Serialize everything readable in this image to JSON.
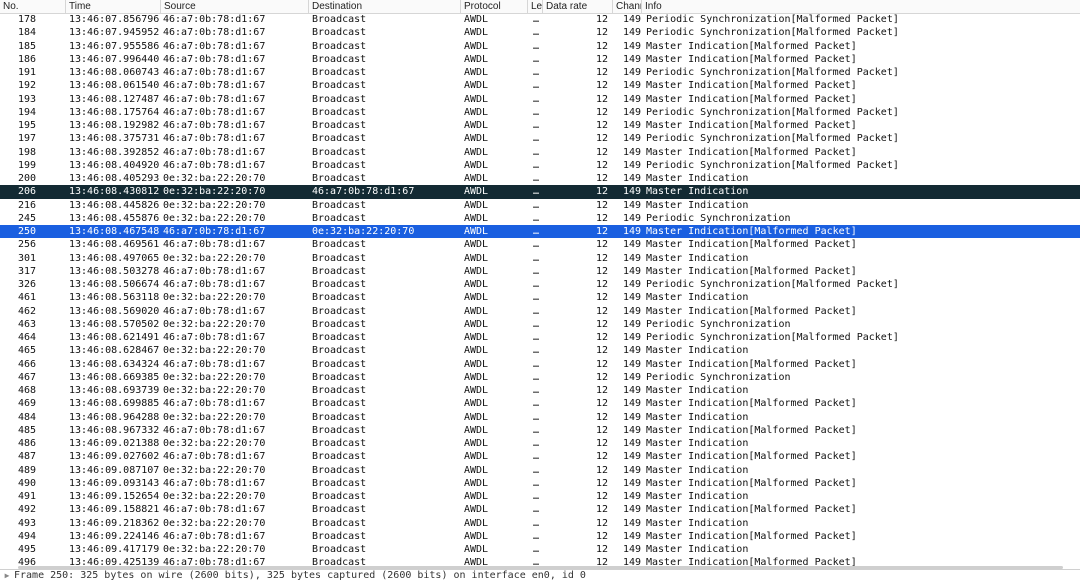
{
  "columns": {
    "no": "No.",
    "time": "Time",
    "source": "Source",
    "destination": "Destination",
    "protocol": "Protocol",
    "length": "Le",
    "data_rate": "Data rate",
    "channel": "Chanr",
    "info": "Info"
  },
  "packets": [
    {
      "no": "178",
      "time": "13:46:07.856796",
      "src": "46:a7:0b:78:d1:67",
      "dst": "Broadcast",
      "proto": "AWDL",
      "len": "…",
      "chan": "12",
      "rate": "149",
      "info": "Periodic Synchronization[Malformed Packet]"
    },
    {
      "no": "184",
      "time": "13:46:07.945952",
      "src": "46:a7:0b:78:d1:67",
      "dst": "Broadcast",
      "proto": "AWDL",
      "len": "…",
      "chan": "12",
      "rate": "149",
      "info": "Periodic Synchronization[Malformed Packet]"
    },
    {
      "no": "185",
      "time": "13:46:07.955586",
      "src": "46:a7:0b:78:d1:67",
      "dst": "Broadcast",
      "proto": "AWDL",
      "len": "…",
      "chan": "12",
      "rate": "149",
      "info": "Master Indication[Malformed Packet]"
    },
    {
      "no": "186",
      "time": "13:46:07.996440",
      "src": "46:a7:0b:78:d1:67",
      "dst": "Broadcast",
      "proto": "AWDL",
      "len": "…",
      "chan": "12",
      "rate": "149",
      "info": "Master Indication[Malformed Packet]"
    },
    {
      "no": "191",
      "time": "13:46:08.060743",
      "src": "46:a7:0b:78:d1:67",
      "dst": "Broadcast",
      "proto": "AWDL",
      "len": "…",
      "chan": "12",
      "rate": "149",
      "info": "Periodic Synchronization[Malformed Packet]"
    },
    {
      "no": "192",
      "time": "13:46:08.061540",
      "src": "46:a7:0b:78:d1:67",
      "dst": "Broadcast",
      "proto": "AWDL",
      "len": "…",
      "chan": "12",
      "rate": "149",
      "info": "Master Indication[Malformed Packet]"
    },
    {
      "no": "193",
      "time": "13:46:08.127487",
      "src": "46:a7:0b:78:d1:67",
      "dst": "Broadcast",
      "proto": "AWDL",
      "len": "…",
      "chan": "12",
      "rate": "149",
      "info": "Master Indication[Malformed Packet]"
    },
    {
      "no": "194",
      "time": "13:46:08.175764",
      "src": "46:a7:0b:78:d1:67",
      "dst": "Broadcast",
      "proto": "AWDL",
      "len": "…",
      "chan": "12",
      "rate": "149",
      "info": "Periodic Synchronization[Malformed Packet]"
    },
    {
      "no": "195",
      "time": "13:46:08.192982",
      "src": "46:a7:0b:78:d1:67",
      "dst": "Broadcast",
      "proto": "AWDL",
      "len": "…",
      "chan": "12",
      "rate": "149",
      "info": "Master Indication[Malformed Packet]"
    },
    {
      "no": "197",
      "time": "13:46:08.375731",
      "src": "46:a7:0b:78:d1:67",
      "dst": "Broadcast",
      "proto": "AWDL",
      "len": "…",
      "chan": "12",
      "rate": "149",
      "info": "Periodic Synchronization[Malformed Packet]"
    },
    {
      "no": "198",
      "time": "13:46:08.392852",
      "src": "46:a7:0b:78:d1:67",
      "dst": "Broadcast",
      "proto": "AWDL",
      "len": "…",
      "chan": "12",
      "rate": "149",
      "info": "Master Indication[Malformed Packet]"
    },
    {
      "no": "199",
      "time": "13:46:08.404920",
      "src": "46:a7:0b:78:d1:67",
      "dst": "Broadcast",
      "proto": "AWDL",
      "len": "…",
      "chan": "12",
      "rate": "149",
      "info": "Periodic Synchronization[Malformed Packet]"
    },
    {
      "no": "200",
      "time": "13:46:08.405293",
      "src": "0e:32:ba:22:20:70",
      "dst": "Broadcast",
      "proto": "AWDL",
      "len": "…",
      "chan": "12",
      "rate": "149",
      "info": "Master Indication"
    },
    {
      "no": "206",
      "time": "13:46:08.430812",
      "src": "0e:32:ba:22:20:70",
      "dst": "46:a7:0b:78:d1:67",
      "proto": "AWDL",
      "len": "…",
      "chan": "12",
      "rate": "149",
      "info": "Master Indication",
      "selected": "dark"
    },
    {
      "no": "216",
      "time": "13:46:08.445826",
      "src": "0e:32:ba:22:20:70",
      "dst": "Broadcast",
      "proto": "AWDL",
      "len": "…",
      "chan": "12",
      "rate": "149",
      "info": "Master Indication"
    },
    {
      "no": "245",
      "time": "13:46:08.455876",
      "src": "0e:32:ba:22:20:70",
      "dst": "Broadcast",
      "proto": "AWDL",
      "len": "…",
      "chan": "12",
      "rate": "149",
      "info": "Periodic Synchronization"
    },
    {
      "no": "250",
      "time": "13:46:08.467548",
      "src": "46:a7:0b:78:d1:67",
      "dst": "0e:32:ba:22:20:70",
      "proto": "AWDL",
      "len": "…",
      "chan": "12",
      "rate": "149",
      "info": "Master Indication[Malformed Packet]",
      "selected": "blue"
    },
    {
      "no": "256",
      "time": "13:46:08.469561",
      "src": "46:a7:0b:78:d1:67",
      "dst": "Broadcast",
      "proto": "AWDL",
      "len": "…",
      "chan": "12",
      "rate": "149",
      "info": "Master Indication[Malformed Packet]"
    },
    {
      "no": "301",
      "time": "13:46:08.497065",
      "src": "0e:32:ba:22:20:70",
      "dst": "Broadcast",
      "proto": "AWDL",
      "len": "…",
      "chan": "12",
      "rate": "149",
      "info": "Master Indication"
    },
    {
      "no": "317",
      "time": "13:46:08.503278",
      "src": "46:a7:0b:78:d1:67",
      "dst": "Broadcast",
      "proto": "AWDL",
      "len": "…",
      "chan": "12",
      "rate": "149",
      "info": "Master Indication[Malformed Packet]"
    },
    {
      "no": "326",
      "time": "13:46:08.506674",
      "src": "46:a7:0b:78:d1:67",
      "dst": "Broadcast",
      "proto": "AWDL",
      "len": "…",
      "chan": "12",
      "rate": "149",
      "info": "Periodic Synchronization[Malformed Packet]"
    },
    {
      "no": "461",
      "time": "13:46:08.563118",
      "src": "0e:32:ba:22:20:70",
      "dst": "Broadcast",
      "proto": "AWDL",
      "len": "…",
      "chan": "12",
      "rate": "149",
      "info": "Master Indication"
    },
    {
      "no": "462",
      "time": "13:46:08.569020",
      "src": "46:a7:0b:78:d1:67",
      "dst": "Broadcast",
      "proto": "AWDL",
      "len": "…",
      "chan": "12",
      "rate": "149",
      "info": "Master Indication[Malformed Packet]"
    },
    {
      "no": "463",
      "time": "13:46:08.570502",
      "src": "0e:32:ba:22:20:70",
      "dst": "Broadcast",
      "proto": "AWDL",
      "len": "…",
      "chan": "12",
      "rate": "149",
      "info": "Periodic Synchronization"
    },
    {
      "no": "464",
      "time": "13:46:08.621491",
      "src": "46:a7:0b:78:d1:67",
      "dst": "Broadcast",
      "proto": "AWDL",
      "len": "…",
      "chan": "12",
      "rate": "149",
      "info": "Periodic Synchronization[Malformed Packet]"
    },
    {
      "no": "465",
      "time": "13:46:08.628467",
      "src": "0e:32:ba:22:20:70",
      "dst": "Broadcast",
      "proto": "AWDL",
      "len": "…",
      "chan": "12",
      "rate": "149",
      "info": "Master Indication"
    },
    {
      "no": "466",
      "time": "13:46:08.634324",
      "src": "46:a7:0b:78:d1:67",
      "dst": "Broadcast",
      "proto": "AWDL",
      "len": "…",
      "chan": "12",
      "rate": "149",
      "info": "Master Indication[Malformed Packet]"
    },
    {
      "no": "467",
      "time": "13:46:08.669385",
      "src": "0e:32:ba:22:20:70",
      "dst": "Broadcast",
      "proto": "AWDL",
      "len": "…",
      "chan": "12",
      "rate": "149",
      "info": "Periodic Synchronization"
    },
    {
      "no": "468",
      "time": "13:46:08.693739",
      "src": "0e:32:ba:22:20:70",
      "dst": "Broadcast",
      "proto": "AWDL",
      "len": "…",
      "chan": "12",
      "rate": "149",
      "info": "Master Indication"
    },
    {
      "no": "469",
      "time": "13:46:08.699885",
      "src": "46:a7:0b:78:d1:67",
      "dst": "Broadcast",
      "proto": "AWDL",
      "len": "…",
      "chan": "12",
      "rate": "149",
      "info": "Master Indication[Malformed Packet]"
    },
    {
      "no": "484",
      "time": "13:46:08.964288",
      "src": "0e:32:ba:22:20:70",
      "dst": "Broadcast",
      "proto": "AWDL",
      "len": "…",
      "chan": "12",
      "rate": "149",
      "info": "Master Indication"
    },
    {
      "no": "485",
      "time": "13:46:08.967332",
      "src": "46:a7:0b:78:d1:67",
      "dst": "Broadcast",
      "proto": "AWDL",
      "len": "…",
      "chan": "12",
      "rate": "149",
      "info": "Master Indication[Malformed Packet]"
    },
    {
      "no": "486",
      "time": "13:46:09.021388",
      "src": "0e:32:ba:22:20:70",
      "dst": "Broadcast",
      "proto": "AWDL",
      "len": "…",
      "chan": "12",
      "rate": "149",
      "info": "Master Indication"
    },
    {
      "no": "487",
      "time": "13:46:09.027602",
      "src": "46:a7:0b:78:d1:67",
      "dst": "Broadcast",
      "proto": "AWDL",
      "len": "…",
      "chan": "12",
      "rate": "149",
      "info": "Master Indication[Malformed Packet]"
    },
    {
      "no": "489",
      "time": "13:46:09.087107",
      "src": "0e:32:ba:22:20:70",
      "dst": "Broadcast",
      "proto": "AWDL",
      "len": "…",
      "chan": "12",
      "rate": "149",
      "info": "Master Indication"
    },
    {
      "no": "490",
      "time": "13:46:09.093143",
      "src": "46:a7:0b:78:d1:67",
      "dst": "Broadcast",
      "proto": "AWDL",
      "len": "…",
      "chan": "12",
      "rate": "149",
      "info": "Master Indication[Malformed Packet]"
    },
    {
      "no": "491",
      "time": "13:46:09.152654",
      "src": "0e:32:ba:22:20:70",
      "dst": "Broadcast",
      "proto": "AWDL",
      "len": "…",
      "chan": "12",
      "rate": "149",
      "info": "Master Indication"
    },
    {
      "no": "492",
      "time": "13:46:09.158821",
      "src": "46:a7:0b:78:d1:67",
      "dst": "Broadcast",
      "proto": "AWDL",
      "len": "…",
      "chan": "12",
      "rate": "149",
      "info": "Master Indication[Malformed Packet]"
    },
    {
      "no": "493",
      "time": "13:46:09.218362",
      "src": "0e:32:ba:22:20:70",
      "dst": "Broadcast",
      "proto": "AWDL",
      "len": "…",
      "chan": "12",
      "rate": "149",
      "info": "Master Indication"
    },
    {
      "no": "494",
      "time": "13:46:09.224146",
      "src": "46:a7:0b:78:d1:67",
      "dst": "Broadcast",
      "proto": "AWDL",
      "len": "…",
      "chan": "12",
      "rate": "149",
      "info": "Master Indication[Malformed Packet]"
    },
    {
      "no": "495",
      "time": "13:46:09.417179",
      "src": "0e:32:ba:22:20:70",
      "dst": "Broadcast",
      "proto": "AWDL",
      "len": "…",
      "chan": "12",
      "rate": "149",
      "info": "Master Indication"
    },
    {
      "no": "496",
      "time": "13:46:09.425139",
      "src": "46:a7:0b:78:d1:67",
      "dst": "Broadcast",
      "proto": "AWDL",
      "len": "…",
      "chan": "12",
      "rate": "149",
      "info": "Master Indication[Malformed Packet]"
    }
  ],
  "detail": {
    "frame_summary": "Frame 250: 325 bytes on wire (2600 bits), 325 bytes captured (2600 bits) on interface en0, id 0",
    "expand_icon": "disclosure-triangle-icon"
  },
  "colors": {
    "selected_dark": "#132a33",
    "selected_blue": "#1a5fe0"
  }
}
